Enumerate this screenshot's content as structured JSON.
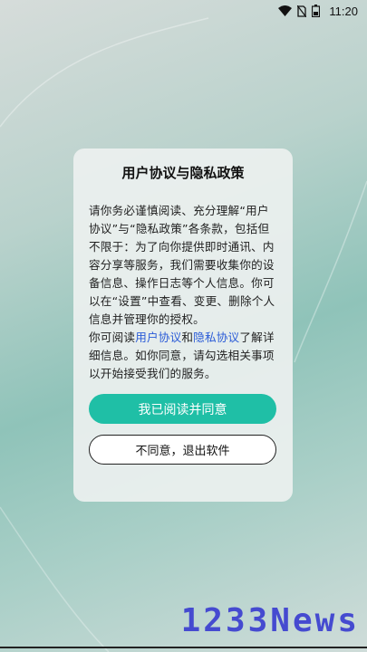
{
  "status_bar": {
    "time": "11:20"
  },
  "dialog": {
    "title": "用户协议与隐私政策",
    "paragraph1": "请你务必谨慎阅读、充分理解“用户协议”与“隐私政策”各条款，包括但不限于：为了向你提供即时通讯、内容分享等服务，我们需要收集你的设备信息、操作日志等个人信息。你可以在“设置”中查看、变更、删除个人信息并管理你的授权。",
    "p2_prefix": "你可阅读",
    "p2_link1": "用户协议",
    "p2_and": "和",
    "p2_link2": "隐私协议",
    "p2_suffix": "了解详细信息。如你同意，请勾选相关事项以开始接受我们的服务。",
    "agree_label": "我已阅读并同意",
    "disagree_label": "不同意，退出软件"
  },
  "watermark": "1233News",
  "colors": {
    "accent": "#1fbfa6",
    "link": "#2a5bd7",
    "watermark": "#3b3fd0"
  }
}
